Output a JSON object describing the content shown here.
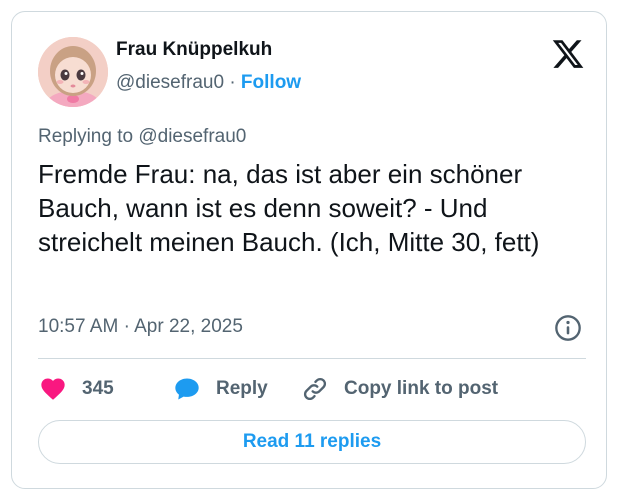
{
  "author": {
    "display_name": "Frau Knüppelkuh",
    "handle": "@diesefrau0",
    "separator": "·",
    "follow_label": "Follow"
  },
  "tweet": {
    "replying_prefix": "Replying to",
    "replying_handle": "@diesefrau0",
    "text": "Fremde Frau: na, das ist aber ein schöner Bauch, wann ist es denn soweit? - Und streichelt meinen Bauch. (Ich, Mitte 30, fett)",
    "time": "10:57 AM",
    "date_separator": "·",
    "date": "Apr 22, 2025"
  },
  "actions": {
    "like_count": "345",
    "reply_label": "Reply",
    "copy_link_label": "Copy link to post"
  },
  "read_replies_label": "Read 11 replies",
  "icons": {
    "brand": "x-logo-icon",
    "info": "info-icon",
    "like": "heart-icon",
    "reply": "speech-bubble-icon",
    "copy": "link-icon"
  },
  "colors": {
    "accent": "#1d9bf0",
    "like": "#f91880",
    "text": "#0f1419",
    "muted": "#536471",
    "border": "#cfd9de"
  }
}
